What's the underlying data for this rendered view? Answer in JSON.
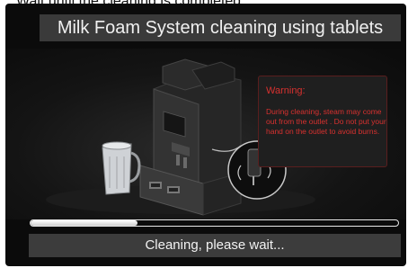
{
  "top_caption": "Wait until the cleaning is completed.",
  "title": "Milk Foam System cleaning using tablets",
  "warning": {
    "title": "Warning:",
    "body": "During cleaning, steam may come out from the outlet . Do not put your hand on the outlet to avoid burns."
  },
  "progress": {
    "fraction": 0.29
  },
  "status": "Cleaning, please wait...",
  "colors": {
    "panel_bg": "#0b0b0b",
    "bar_bg": "#3a3a3a",
    "warning_red": "#d8312f",
    "progress_fill": "#e8e8e8"
  },
  "icons": {
    "illustration": "coffee-machine-with-milk-jug",
    "callout": "steam-outlet-callout-icon"
  }
}
